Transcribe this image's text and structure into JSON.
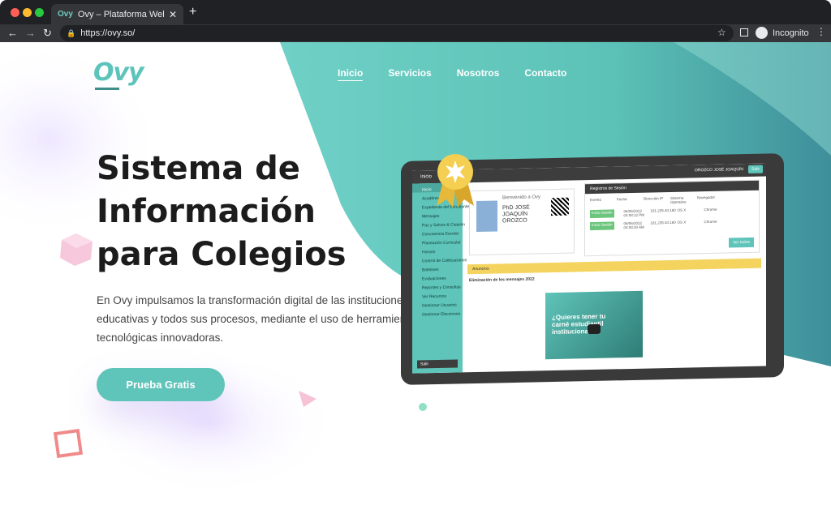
{
  "browser": {
    "tab_title": "Ovy – Plataforma Web para Co",
    "tab_favicon": "Ovy",
    "tab_close": "✕",
    "new_tab": "+",
    "url": "https://ovy.so/",
    "profile_label": "Incognito",
    "icons": {
      "back": "back-arrow-icon",
      "forward": "forward-arrow-icon",
      "reload": "reload-icon",
      "lock": "lock-icon",
      "bookmark": "star-icon",
      "sidepanel": "side-panel-icon",
      "menu": "kebab-menu-icon"
    }
  },
  "nav": {
    "logo_text": "Ovy",
    "items": [
      {
        "label": "Inicio",
        "active": true
      },
      {
        "label": "Servicios",
        "active": false
      },
      {
        "label": "Nosotros",
        "active": false
      },
      {
        "label": "Contacto",
        "active": false
      }
    ]
  },
  "hero": {
    "headline_line1": "Sistema de",
    "headline_line2": "Información",
    "headline_line3": "para Colegios",
    "lead": "En Ovy impulsamos la transformación digital  de las instituciones educativas y todos sus procesos, mediante el uso de herramientas tecnológicas innovadoras.",
    "cta_label": "Prueba Gratis"
  },
  "mockup": {
    "topbar_title": "Inicio",
    "topbar_user": "OROZCO JOSÉ JOAQUÍN",
    "topbar_exit": "Salir",
    "sidebar": [
      "Inicio",
      "Académico",
      "Expediente del Estudiante",
      "Mensajes",
      "Paz y Salvos & Citación",
      "Convivencia Escolar",
      "Planeación Curricular",
      "Horario",
      "Control de Calificaciones",
      "Boletines",
      "Evaluaciones",
      "Reportes y Consultas",
      "Ver Recursos",
      "Gestionar Usuarios",
      "Gestionar Elecciones"
    ],
    "sidebar_logout": "Salir",
    "welcome_text": "Bienvenido a Ovy",
    "user_name": "PhD JOSÉ JOAQUÍN OROZCO",
    "log_title": "Registros de Sesión",
    "log_headers": [
      "Evento",
      "Fecha",
      "Dirección IP",
      "Sistema Operativo",
      "Navegador"
    ],
    "log_rows": [
      [
        "Inicio Sesión",
        "06/06/2022 04:08:12 PM",
        "181.235.40.180",
        "OS X",
        "Chrome"
      ],
      [
        "Inicio Sesión",
        "06/06/2022 04:08:30 AM",
        "181.235.40.180",
        "OS X",
        "Chrome"
      ]
    ],
    "log_button": "Ver todos",
    "announcements_label": "Anuncios",
    "announcement_title": "Eliminación de los mensajes 2022",
    "announcement_image_text": "¿Quieres tener tu carné estudiantil institucional?"
  },
  "colors": {
    "teal": "#5fc4b9",
    "dark": "#1c1c1c",
    "cta": "#5fc4b9"
  }
}
